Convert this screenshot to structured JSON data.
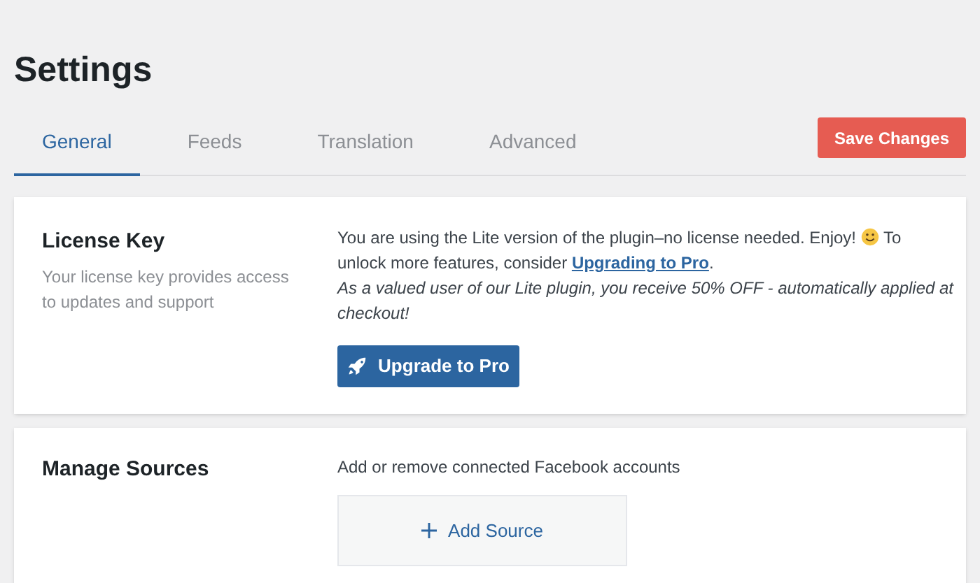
{
  "page": {
    "title": "Settings"
  },
  "tabs": [
    {
      "label": "General",
      "selected": true
    },
    {
      "label": "Feeds",
      "selected": false
    },
    {
      "label": "Translation",
      "selected": false
    },
    {
      "label": "Advanced",
      "selected": false
    }
  ],
  "save_button": "Save Changes",
  "license": {
    "title": "License Key",
    "description": "Your license key provides access to updates and support",
    "message_before": "You are using the Lite version of the plugin–no license needed. Enjoy!",
    "message_after": "To unlock more features, consider",
    "link": "Upgrading to Pro",
    "message_end": ".",
    "offer": "As a valued user of our Lite plugin, you receive 50% OFF - automatically applied at checkout!",
    "button": "Upgrade to Pro"
  },
  "sources": {
    "title": "Manage Sources",
    "description": "Add or remove connected Facebook accounts",
    "add_button": "Add Source"
  }
}
